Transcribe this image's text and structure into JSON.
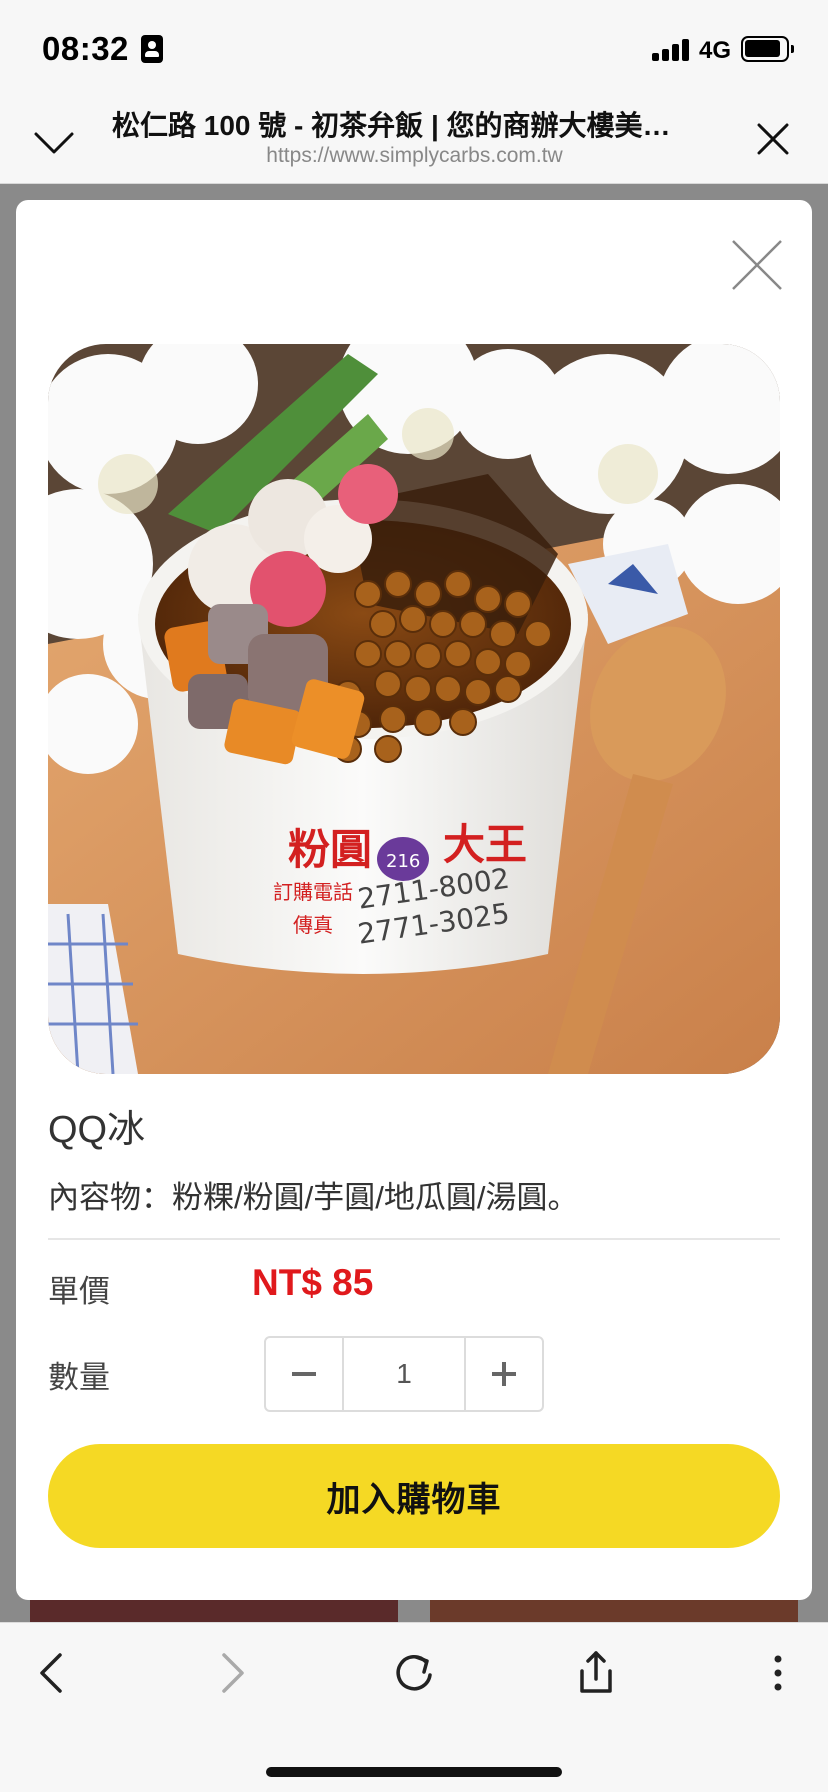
{
  "status_bar": {
    "time": "08:32",
    "network": "4G"
  },
  "browser": {
    "title": "松仁路 100 號 - 初茶弁飯 | 您的商辦大樓美…",
    "url": "https://www.simplycarbs.com.tw"
  },
  "modal": {
    "product_name": "QQ冰",
    "description": "內容物：粉粿/粉圓/芋圓/地瓜圓/湯圓。",
    "price_label": "單價",
    "price_value": "NT$ 85",
    "quantity_label": "數量",
    "quantity_value": "1",
    "add_to_cart_label": "加入購物車",
    "product_image": {
      "cup_brand": "粉圓",
      "cup_brand_right": "大王",
      "cup_badge": "216",
      "cup_phone_label": "訂購電話",
      "cup_phone": "2711-8002",
      "cup_fax_label": "傳真",
      "cup_fax": "2771-3025"
    }
  },
  "toolbar": {
    "icons": [
      "back-icon",
      "forward-icon",
      "reload-icon",
      "share-icon",
      "more-icon"
    ]
  },
  "colors": {
    "accent_yellow": "#f5d924",
    "price_red": "#e0191c"
  }
}
